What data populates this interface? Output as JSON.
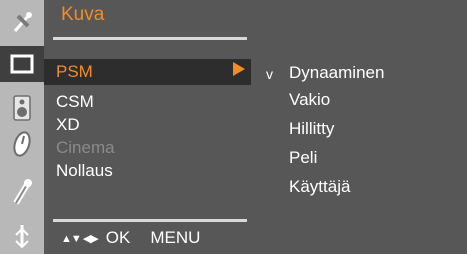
{
  "menu": {
    "title": "Kuva",
    "selected_item": "PSM",
    "items": [
      "CSM",
      "XD",
      "Cinema",
      "Nollaus"
    ],
    "disabled_items": [
      "Cinema"
    ]
  },
  "footer": {
    "nav_glyphs": "▲▼ ◀▶",
    "ok_label": "OK",
    "menu_label": "MENU"
  },
  "submenu": {
    "check_mark": "v",
    "items": [
      "Dynaaminen",
      "Vakio",
      "Hillitty",
      "Peli",
      "Käyttäjä"
    ],
    "selected": "Dynaaminen"
  },
  "colors": {
    "accent": "#f28c28",
    "panel": "#575757",
    "highlight": "#2d2d2d",
    "icon_column": "#b8b8b8"
  },
  "icons": [
    "satellite-icon",
    "screen-icon",
    "speaker-icon",
    "clock-icon",
    "wrench-icon",
    "joystick-icon"
  ]
}
